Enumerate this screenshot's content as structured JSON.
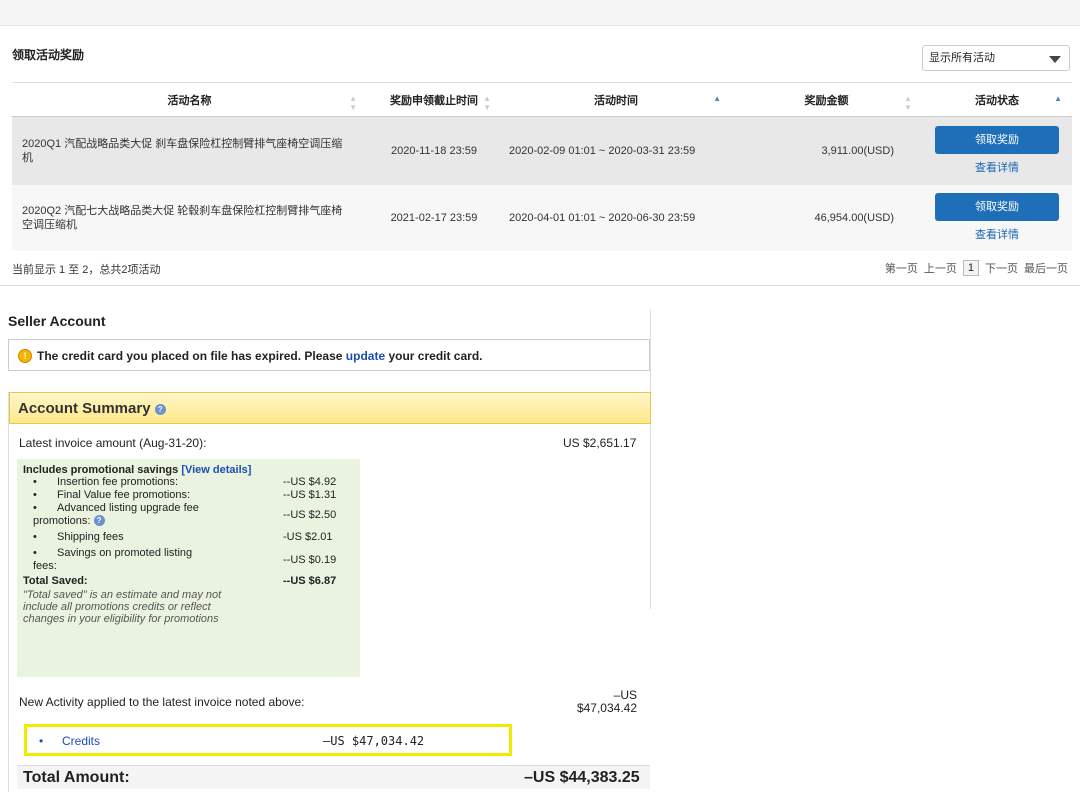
{
  "rewards": {
    "title": "领取活动奖励",
    "filter_value": "显示所有活动",
    "columns": [
      "活动名称",
      "奖励申领截止时间",
      "活动时间",
      "奖励金额",
      "活动状态"
    ],
    "rows": [
      {
        "name": "2020Q1 汽配战略品类大促 刹车盘保险杠控制臂排气座椅空调压缩机",
        "deadline": "2020-11-18 23:59",
        "period": "2020-02-09 01:01 ~ 2020-03-31 23:59",
        "amount": "3,911.00(USD)",
        "claim_label": "领取奖励",
        "detail_label": "查看详情"
      },
      {
        "name": "2020Q2 汽配七大战略品类大促 轮毂刹车盘保险杠控制臂排气座椅空调压缩机",
        "deadline": "2021-02-17 23:59",
        "period": "2020-04-01 01:01 ~ 2020-06-30 23:59",
        "amount": "46,954.00(USD)",
        "claim_label": "领取奖励",
        "detail_label": "查看详情"
      }
    ],
    "count_text": "当前显示 1 至 2，总共2项活动",
    "pager": {
      "first": "第一页",
      "prev": "上一页",
      "current": "1",
      "next": "下一页",
      "last": "最后一页"
    }
  },
  "seller": {
    "title": "Seller Account",
    "alert_prefix": "The credit card you placed on file has expired. Please ",
    "alert_link": "update",
    "alert_suffix": " your credit card.",
    "summary_title": "Account Summary",
    "invoice_label": "Latest invoice amount (Aug-31-20):",
    "invoice_amount": "US $2,651.17",
    "promo_header": "Includes promotional savings",
    "promo_link": "[View details]",
    "promo_items": [
      {
        "label": "Insertion fee promotions:",
        "value": "--US $4.92"
      },
      {
        "label": "Final Value fee promotions:",
        "value": "--US $1.31"
      },
      {
        "label": "Advanced listing upgrade fee",
        "label2": "promotions:",
        "value": "--US $2.50"
      },
      {
        "label": "Shipping fees",
        "value": "-US $2.01"
      },
      {
        "label": "Savings on promoted listing",
        "label2": "fees:",
        "value": "--US $0.19"
      }
    ],
    "total_saved_label": "Total Saved:",
    "total_saved_value": "--US $6.87",
    "promo_note": "\"Total saved\" is an estimate and may not include all promotions credits or reflect changes in your eligibility for promotions",
    "activity_label": "New Activity applied to the latest invoice noted above:",
    "activity_amount_line1": "–US",
    "activity_amount_line2": "$47,034.42",
    "credits_label": "Credits",
    "credits_value": "–US $47,034.42",
    "total_label": "Total Amount:",
    "total_value": "–US $44,383.25"
  }
}
